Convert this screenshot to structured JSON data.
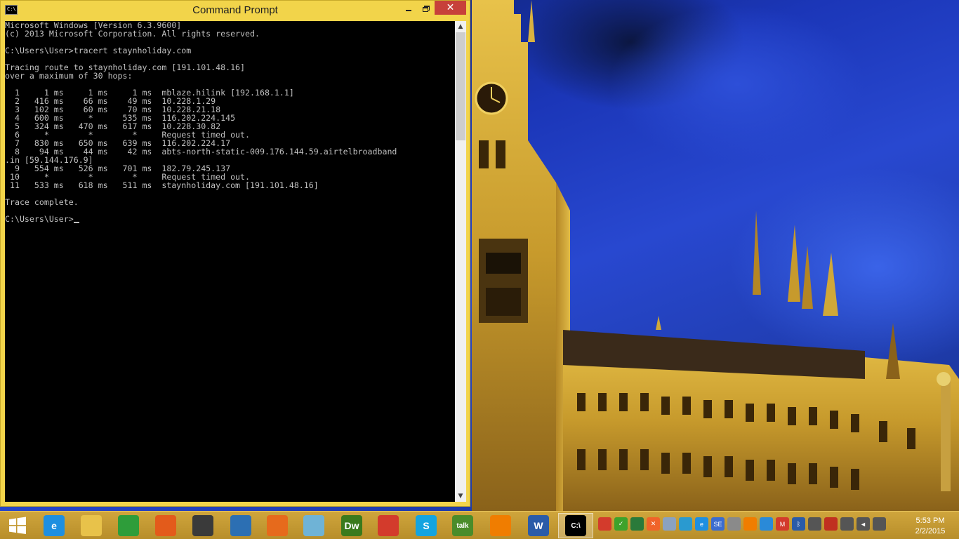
{
  "window": {
    "title": "Command Prompt",
    "icon_text": "C:\\",
    "minimize_icon": "minimize-icon",
    "maximize_icon": "restore-icon",
    "close_label": "✕"
  },
  "console": {
    "lines": [
      "Microsoft Windows [Version 6.3.9600]",
      "(c) 2013 Microsoft Corporation. All rights reserved.",
      "",
      "C:\\Users\\User>tracert staynholiday.com",
      "",
      "Tracing route to staynholiday.com [191.101.48.16]",
      "over a maximum of 30 hops:",
      "",
      "  1     1 ms     1 ms     1 ms  mblaze.hilink [192.168.1.1]",
      "  2   416 ms    66 ms    49 ms  10.228.1.29",
      "  3   102 ms    60 ms    70 ms  10.228.21.18",
      "  4   600 ms     *      535 ms  116.202.224.145",
      "  5   324 ms   470 ms   617 ms  10.228.30.82",
      "  6     *        *        *     Request timed out.",
      "  7   830 ms   650 ms   639 ms  116.202.224.17",
      "  8    94 ms    44 ms    42 ms  abts-north-static-009.176.144.59.airtelbroadband",
      ".in [59.144.176.9]",
      "  9   554 ms   526 ms   701 ms  182.79.245.137",
      " 10     *        *        *     Request timed out.",
      " 11   533 ms   618 ms   511 ms  staynholiday.com [191.101.48.16]",
      "",
      "Trace complete.",
      ""
    ],
    "prompt": "C:\\Users\\User>"
  },
  "scrollbar": {
    "up": "▲",
    "down": "▼"
  },
  "taskbar": {
    "pinned": [
      {
        "name": "windows-start-icon",
        "label": "",
        "color": "#1e73d2"
      },
      {
        "name": "internet-explorer-icon",
        "label": "e",
        "color": "#1e8fe0"
      },
      {
        "name": "file-explorer-icon",
        "label": "",
        "color": "#e8c24a"
      },
      {
        "name": "store-icon",
        "label": "",
        "color": "#2e9d3a"
      },
      {
        "name": "office-icon",
        "label": "",
        "color": "#e35b1b"
      },
      {
        "name": "app-icon",
        "label": "",
        "color": "#3a3a3a"
      },
      {
        "name": "camera-app-icon",
        "label": "",
        "color": "#2c6fb3"
      },
      {
        "name": "firefox-icon",
        "label": "",
        "color": "#e66a1c"
      },
      {
        "name": "notes-icon",
        "label": "",
        "color": "#6fb3d6"
      },
      {
        "name": "dreamweaver-icon",
        "label": "Dw",
        "color": "#3a7a1c"
      },
      {
        "name": "chrome-icon",
        "label": "",
        "color": "#d33b2c"
      },
      {
        "name": "skype-icon",
        "label": "S",
        "color": "#13a4e0"
      },
      {
        "name": "google-talk-icon",
        "label": "talk",
        "color": "#4a8c2a"
      },
      {
        "name": "vlc-icon",
        "label": "",
        "color": "#f07d00"
      },
      {
        "name": "word-icon",
        "label": "W",
        "color": "#2a5ba8"
      },
      {
        "name": "command-prompt-icon",
        "label": "C:\\",
        "color": "#000000"
      }
    ],
    "tray": [
      {
        "name": "chrome-tray-icon",
        "color": "#d33b2c",
        "label": ""
      },
      {
        "name": "shield-check-icon",
        "color": "#3da22b",
        "label": "✓"
      },
      {
        "name": "network-tool-icon",
        "color": "#2a7a3a",
        "label": ""
      },
      {
        "name": "xampp-icon",
        "color": "#f0642a",
        "label": "✕"
      },
      {
        "name": "cloud-icon",
        "color": "#8aa2c0",
        "label": ""
      },
      {
        "name": "app-tray-icon",
        "color": "#2a9ad0",
        "label": ""
      },
      {
        "name": "ie-tray-icon",
        "color": "#1e8fe0",
        "label": "e"
      },
      {
        "name": "se-icon",
        "color": "#3b6ccf",
        "label": "SE"
      },
      {
        "name": "link-icon",
        "color": "#8a8a8a",
        "label": ""
      },
      {
        "name": "vlc-tray-icon",
        "color": "#f07d00",
        "label": ""
      },
      {
        "name": "sync-icon",
        "color": "#2a8ad8",
        "label": ""
      },
      {
        "name": "gmail-icon",
        "color": "#d33b2c",
        "label": "M"
      },
      {
        "name": "bluetooth-icon",
        "color": "#2a5ba8",
        "label": "ᛒ"
      },
      {
        "name": "display-icon",
        "color": "#555555",
        "label": ""
      },
      {
        "name": "flag-icon",
        "color": "#c03020",
        "label": ""
      },
      {
        "name": "battery-icon",
        "color": "#555555",
        "label": ""
      },
      {
        "name": "volume-icon",
        "color": "#555555",
        "label": "◄"
      },
      {
        "name": "signal-icon",
        "color": "#555555",
        "label": ""
      }
    ],
    "time": "5:53 PM",
    "date": "2/2/2015"
  }
}
